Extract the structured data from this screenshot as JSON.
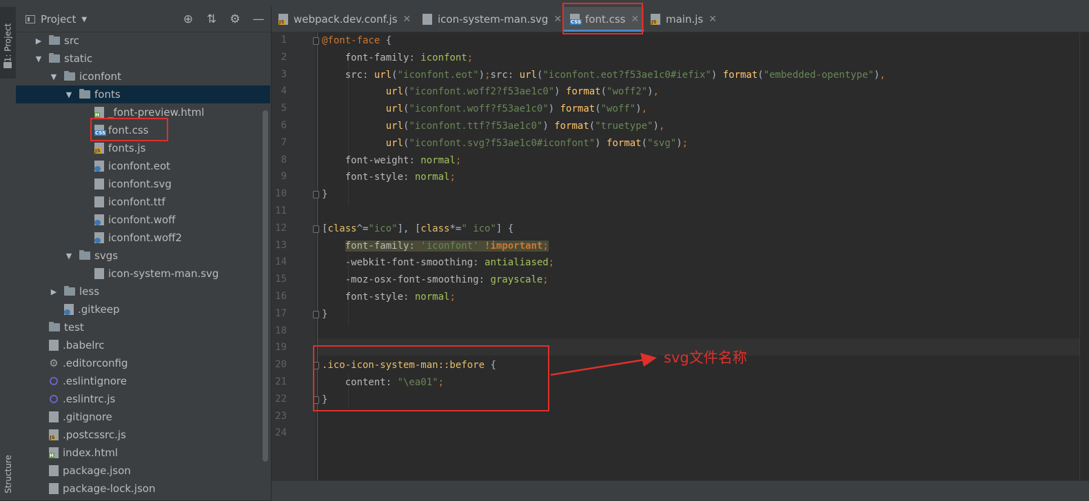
{
  "left_stripe": {
    "project_tab": "1: Project",
    "structure_tab": "Structure"
  },
  "project_panel": {
    "title": "Project",
    "header_icons": [
      "crosshair-icon",
      "collapse-icon",
      "gear-icon",
      "minimize-icon"
    ],
    "tree": [
      {
        "label": "src",
        "kind": "folder",
        "arrow": "▶",
        "indent": 1
      },
      {
        "label": "static",
        "kind": "folder",
        "arrow": "▼",
        "indent": 1
      },
      {
        "label": "iconfont",
        "kind": "folder",
        "arrow": "▼",
        "indent": 2
      },
      {
        "label": "fonts",
        "kind": "folder",
        "arrow": "▼",
        "indent": 3,
        "selected": true
      },
      {
        "label": "_font-preview.html",
        "kind": "html",
        "indent": 4
      },
      {
        "label": "font.css",
        "kind": "css",
        "indent": 4,
        "highlighted": true
      },
      {
        "label": "fonts.js",
        "kind": "js",
        "indent": 4
      },
      {
        "label": "iconfont.eot",
        "kind": "unk",
        "indent": 4
      },
      {
        "label": "iconfont.svg",
        "kind": "svg",
        "indent": 4
      },
      {
        "label": "iconfont.ttf",
        "kind": "file",
        "indent": 4
      },
      {
        "label": "iconfont.woff",
        "kind": "unk",
        "indent": 4
      },
      {
        "label": "iconfont.woff2",
        "kind": "unk",
        "indent": 4
      },
      {
        "label": "svgs",
        "kind": "folder",
        "arrow": "▼",
        "indent": 3
      },
      {
        "label": "icon-system-man.svg",
        "kind": "svg",
        "indent": 4
      },
      {
        "label": "less",
        "kind": "folder",
        "arrow": "▶",
        "indent": 2
      },
      {
        "label": ".gitkeep",
        "kind": "unk",
        "indent": 2
      },
      {
        "label": "test",
        "kind": "folder",
        "indent": 1
      },
      {
        "label": ".babelrc",
        "kind": "file",
        "indent": 1
      },
      {
        "label": ".editorconfig",
        "kind": "gear",
        "indent": 1
      },
      {
        "label": ".eslintignore",
        "kind": "eslint",
        "indent": 1
      },
      {
        "label": ".eslintrc.js",
        "kind": "eslint",
        "indent": 1
      },
      {
        "label": ".gitignore",
        "kind": "file",
        "indent": 1
      },
      {
        "label": ".postcssrc.js",
        "kind": "js",
        "indent": 1
      },
      {
        "label": "index.html",
        "kind": "html",
        "indent": 1
      },
      {
        "label": "package.json",
        "kind": "file",
        "indent": 1
      },
      {
        "label": "package-lock.json",
        "kind": "file",
        "indent": 1
      }
    ]
  },
  "tabs": [
    {
      "label": "webpack.dev.conf.js",
      "kind": "js",
      "active": false
    },
    {
      "label": "icon-system-man.svg",
      "kind": "svg",
      "active": false
    },
    {
      "label": "font.css",
      "kind": "css",
      "active": true
    },
    {
      "label": "main.js",
      "kind": "js",
      "active": false
    }
  ],
  "editor": {
    "line_numbers": [
      "1",
      "2",
      "3",
      "4",
      "5",
      "6",
      "7",
      "8",
      "9",
      "10",
      "11",
      "12",
      "13",
      "14",
      "15",
      "16",
      "17",
      "18",
      "19",
      "20",
      "21",
      "22",
      "23",
      "24"
    ],
    "current_line": "19",
    "lines": [
      [
        [
          "kw",
          "@font-face"
        ],
        [
          "",
          " {"
        ]
      ],
      [
        [
          "prop",
          "    font-family"
        ],
        [
          "",
          ": "
        ],
        [
          "val",
          "iconfont"
        ],
        [
          "kw",
          ";"
        ]
      ],
      [
        [
          "prop",
          "    src"
        ],
        [
          "",
          ": "
        ],
        [
          "fn",
          "url"
        ],
        [
          "",
          "("
        ],
        [
          "str",
          "\"iconfont.eot\""
        ],
        [
          "",
          ")"
        ],
        [
          "kw",
          ";"
        ],
        [
          "prop",
          "src"
        ],
        [
          "",
          ": "
        ],
        [
          "fn",
          "url"
        ],
        [
          "",
          "("
        ],
        [
          "str",
          "\"iconfont.eot?f53ae1c0#iefix\""
        ],
        [
          "",
          ") "
        ],
        [
          "fn",
          "format"
        ],
        [
          "",
          "("
        ],
        [
          "str",
          "\"embedded-opentype\""
        ],
        [
          "",
          ")"
        ],
        [
          "kw",
          ","
        ]
      ],
      [
        [
          "",
          "           "
        ],
        [
          "fn",
          "url"
        ],
        [
          "",
          "("
        ],
        [
          "str",
          "\"iconfont.woff2?f53ae1c0\""
        ],
        [
          "",
          ") "
        ],
        [
          "fn",
          "format"
        ],
        [
          "",
          "("
        ],
        [
          "str",
          "\"woff2\""
        ],
        [
          "",
          ")"
        ],
        [
          "kw",
          ","
        ]
      ],
      [
        [
          "",
          "           "
        ],
        [
          "fn",
          "url"
        ],
        [
          "",
          "("
        ],
        [
          "str",
          "\"iconfont.woff?f53ae1c0\""
        ],
        [
          "",
          ") "
        ],
        [
          "fn",
          "format"
        ],
        [
          "",
          "("
        ],
        [
          "str",
          "\"woff\""
        ],
        [
          "",
          ")"
        ],
        [
          "kw",
          ","
        ]
      ],
      [
        [
          "",
          "           "
        ],
        [
          "fn",
          "url"
        ],
        [
          "",
          "("
        ],
        [
          "str",
          "\"iconfont.ttf?f53ae1c0\""
        ],
        [
          "",
          ") "
        ],
        [
          "fn",
          "format"
        ],
        [
          "",
          "("
        ],
        [
          "str",
          "\"truetype\""
        ],
        [
          "",
          ")"
        ],
        [
          "kw",
          ","
        ]
      ],
      [
        [
          "",
          "           "
        ],
        [
          "fn",
          "url"
        ],
        [
          "",
          "("
        ],
        [
          "str",
          "\"iconfont.svg?f53ae1c0#iconfont\""
        ],
        [
          "",
          ") "
        ],
        [
          "fn",
          "format"
        ],
        [
          "",
          "("
        ],
        [
          "str",
          "\"svg\""
        ],
        [
          "",
          ")"
        ],
        [
          "kw",
          ";"
        ]
      ],
      [
        [
          "prop",
          "    font-weight"
        ],
        [
          "",
          ": "
        ],
        [
          "val",
          "normal"
        ],
        [
          "kw",
          ";"
        ]
      ],
      [
        [
          "prop",
          "    font-style"
        ],
        [
          "",
          ": "
        ],
        [
          "val",
          "normal"
        ],
        [
          "kw",
          ";"
        ]
      ],
      [
        [
          "",
          "}"
        ]
      ],
      [],
      [
        [
          "",
          "["
        ],
        [
          "sel",
          "class"
        ],
        [
          "",
          "^="
        ],
        [
          "str",
          "\"ico\""
        ],
        [
          "",
          "], ["
        ],
        [
          "sel",
          "class"
        ],
        [
          "",
          "*="
        ],
        [
          "str",
          "\" ico\""
        ],
        [
          "",
          "] {"
        ]
      ],
      [
        [
          "",
          "    "
        ],
        [
          "hl prop",
          "font-family"
        ],
        [
          "hl",
          ": "
        ],
        [
          "hl str",
          "'iconfont'"
        ],
        [
          "hl",
          " "
        ],
        [
          "hl imp",
          "!important"
        ],
        [
          "hl kw",
          ";"
        ]
      ],
      [
        [
          "prop",
          "    -webkit-font-smoothing"
        ],
        [
          "",
          ": "
        ],
        [
          "val",
          "antialiased"
        ],
        [
          "kw",
          ";"
        ]
      ],
      [
        [
          "prop",
          "    -moz-osx-font-smoothing"
        ],
        [
          "",
          ": "
        ],
        [
          "val",
          "grayscale"
        ],
        [
          "kw",
          ";"
        ]
      ],
      [
        [
          "prop",
          "    font-style"
        ],
        [
          "",
          ": "
        ],
        [
          "val",
          "normal"
        ],
        [
          "kw",
          ";"
        ]
      ],
      [
        [
          "",
          "}"
        ]
      ],
      [],
      [],
      [
        [
          "sel",
          ".ico-icon-system-man::before"
        ],
        [
          "",
          " {"
        ]
      ],
      [
        [
          "prop",
          "    content"
        ],
        [
          "",
          ": "
        ],
        [
          "str",
          "\"\\ea01\""
        ],
        [
          "kw",
          ";"
        ]
      ],
      [
        [
          "",
          "}"
        ]
      ],
      [],
      []
    ]
  },
  "annotation": {
    "text": "svg文件名称"
  }
}
